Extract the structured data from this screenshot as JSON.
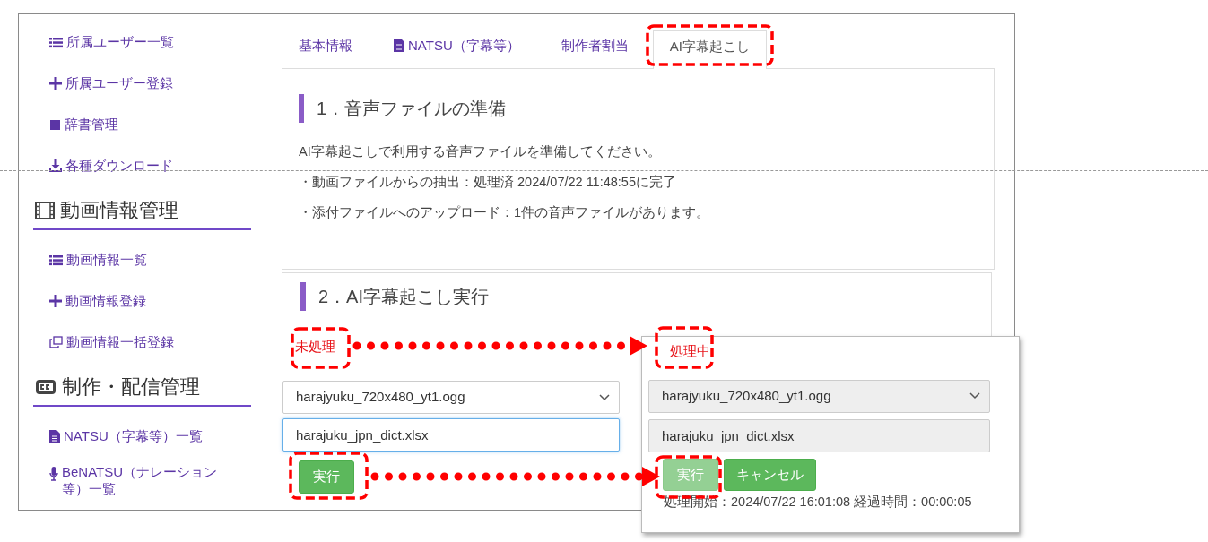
{
  "sidebar": {
    "items": [
      {
        "kind": "link",
        "label": "所属ユーザー一覧"
      },
      {
        "kind": "link",
        "label": "所属ユーザー登録"
      },
      {
        "kind": "link",
        "label": "辞書管理"
      },
      {
        "kind": "link",
        "label": "各種ダウンロード"
      },
      {
        "kind": "heading",
        "label": "動画情報管理"
      },
      {
        "kind": "link",
        "label": "動画情報一覧"
      },
      {
        "kind": "link",
        "label": "動画情報登録"
      },
      {
        "kind": "link",
        "label": "動画情報一括登録"
      },
      {
        "kind": "heading",
        "label": "制作・配信管理"
      },
      {
        "kind": "link",
        "label": "NATSU（字幕等）一覧"
      },
      {
        "kind": "link",
        "label": "BeNATSU（ナレーション等）一覧"
      }
    ]
  },
  "tabs": [
    {
      "label": "基本情報",
      "selected": false
    },
    {
      "label": "NATSU（字幕等）",
      "selected": false
    },
    {
      "label": "制作者割当",
      "selected": false
    },
    {
      "label": "AI字幕起こし",
      "selected": true
    }
  ],
  "section_1": {
    "heading": "1．音声ファイルの準備",
    "paragraphs": [
      "AI字幕起こしで利用する音声ファイルを準備してください。",
      "・動画ファイルからの抽出：処理済 2024/07/22 11:48:55に完了",
      "・添付ファイルへのアップロード：1件の音声ファイルがあります。"
    ]
  },
  "section_2": {
    "heading": "2．AI字幕起こし実行",
    "status": "未処理",
    "audio_select": {
      "value": "harajyuku_720x480_yt1.ogg",
      "disabled": false
    },
    "dictionary_field": {
      "value": "harajuku_jpn_dict.xlsx",
      "disabled": false,
      "focused": true
    },
    "buttons": [
      {
        "kind": "run",
        "label": "実行",
        "disabled": false
      }
    ]
  },
  "processing_panel": {
    "status": "処理中",
    "audio_select": {
      "value": "harajyuku_720x480_yt1.ogg",
      "disabled": true
    },
    "dictionary_field": {
      "value": "harajuku_jpn_dict.xlsx",
      "disabled": true,
      "focused": false
    },
    "buttons": [
      {
        "kind": "run",
        "label": "実行",
        "disabled": true
      },
      {
        "kind": "cancel",
        "label": "キャンセル",
        "disabled": false
      }
    ],
    "progress_text": "処理開始：2024/07/22 16:01:08 経過時間：00:00:05"
  }
}
